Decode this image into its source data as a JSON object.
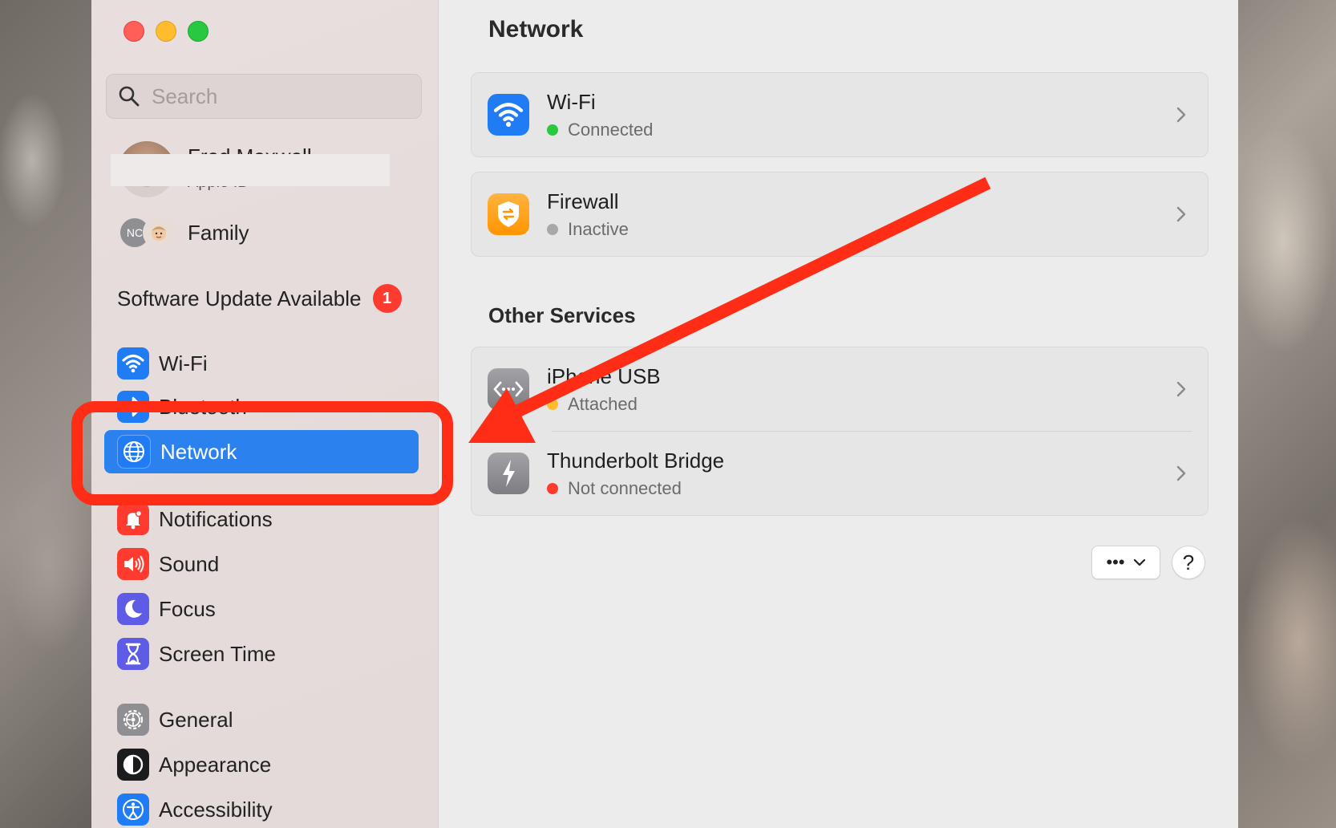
{
  "sidebar": {
    "search_placeholder": "Search",
    "apple_id": {
      "name": "Fred Maxwell",
      "subtitle": "Apple ID"
    },
    "family": {
      "label": "Family",
      "avatar_initials": "NC"
    },
    "software_update": {
      "label": "Software Update Available",
      "badge": "1"
    },
    "items": [
      {
        "label": "Wi-Fi",
        "icon": "wifi-icon",
        "color": "#1f7cf5"
      },
      {
        "label": "Bluetooth",
        "icon": "bluetooth-icon",
        "color": "#1f7cf5"
      },
      {
        "label": "Network",
        "icon": "globe-icon",
        "color": "#1f7cf5",
        "selected": true
      },
      {
        "label": "Notifications",
        "icon": "bell-icon",
        "color": "#ff3b30"
      },
      {
        "label": "Sound",
        "icon": "speaker-icon",
        "color": "#ff3b30"
      },
      {
        "label": "Focus",
        "icon": "moon-icon",
        "color": "#5e5ce6"
      },
      {
        "label": "Screen Time",
        "icon": "hourglass-icon",
        "color": "#5e5ce6"
      },
      {
        "label": "General",
        "icon": "gear-icon",
        "color": "#8e8e93"
      },
      {
        "label": "Appearance",
        "icon": "appearance-icon",
        "color": "#1c1c1e"
      },
      {
        "label": "Accessibility",
        "icon": "accessibility-icon",
        "color": "#1f7cf5"
      }
    ]
  },
  "main": {
    "title": "Network",
    "services": [
      {
        "name": "Wi-Fi",
        "status": "Connected",
        "status_color": "#28c840",
        "icon": "wifi-icon"
      },
      {
        "name": "Firewall",
        "status": "Inactive",
        "status_color": "#a8a8a8",
        "icon": "firewall-icon"
      }
    ],
    "other_services_title": "Other Services",
    "other_services": [
      {
        "name": "iPhone USB",
        "status": "Attached",
        "status_color": "#febc2e",
        "icon": "usb-network-icon"
      },
      {
        "name": "Thunderbolt Bridge",
        "status": "Not connected",
        "status_color": "#ff3b30",
        "icon": "thunderbolt-icon"
      }
    ],
    "more_button": "•••",
    "help_button": "?"
  },
  "colors": {
    "accent": "#2b82ee",
    "annotation": "#ff2d16"
  }
}
